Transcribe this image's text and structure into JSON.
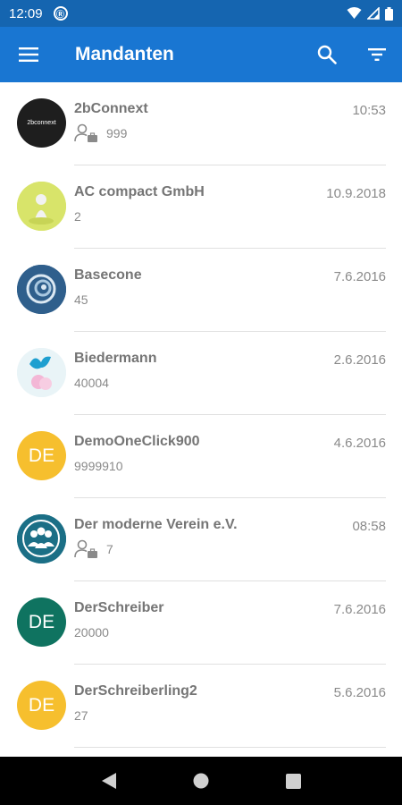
{
  "status_bar": {
    "time": "12:09",
    "app_icon": "badge-icon"
  },
  "app_bar": {
    "title": "Mandanten",
    "menu_icon": "menu-icon",
    "search_icon": "search-icon",
    "filter_icon": "filter-icon",
    "color": "#1976d2"
  },
  "clients": [
    {
      "name": "2bConnext",
      "date": "10:53",
      "sub": "999",
      "has_contact_icon": true,
      "avatar": {
        "type": "logo",
        "logo_text": "2bconnext",
        "bg": "#1e1e1e"
      }
    },
    {
      "name": "AC compact GmbH",
      "date": "10.9.2018",
      "sub": "2",
      "has_contact_icon": false,
      "avatar": {
        "type": "image",
        "bg": "#d8e46a"
      }
    },
    {
      "name": "Basecone",
      "date": "7.6.2016",
      "sub": "45",
      "has_contact_icon": false,
      "avatar": {
        "type": "image",
        "bg": "#2f5f8c"
      }
    },
    {
      "name": "Biedermann",
      "date": "2.6.2016",
      "sub": "40004",
      "has_contact_icon": false,
      "avatar": {
        "type": "image",
        "bg": "#e9f4f7"
      }
    },
    {
      "name": "DemoOneClick900",
      "date": "4.6.2016",
      "sub": "9999910",
      "has_contact_icon": false,
      "avatar": {
        "type": "initials",
        "initials": "DE",
        "bg": "#f6bf2e"
      }
    },
    {
      "name": "Der moderne Verein e.V.",
      "date": "08:58",
      "sub": "7",
      "has_contact_icon": true,
      "avatar": {
        "type": "image",
        "bg": "#1b6f86"
      }
    },
    {
      "name": "DerSchreiber",
      "date": "7.6.2016",
      "sub": "20000",
      "has_contact_icon": false,
      "avatar": {
        "type": "initials",
        "initials": "DE",
        "bg": "#0f7360"
      }
    },
    {
      "name": "DerSchreiberling2",
      "date": "5.6.2016",
      "sub": "27",
      "has_contact_icon": false,
      "avatar": {
        "type": "initials",
        "initials": "DE",
        "bg": "#f6bf2e"
      }
    }
  ],
  "nav_bar": {
    "back_icon": "back-triangle-icon",
    "home_icon": "home-circle-icon",
    "recents_icon": "recents-square-icon"
  }
}
